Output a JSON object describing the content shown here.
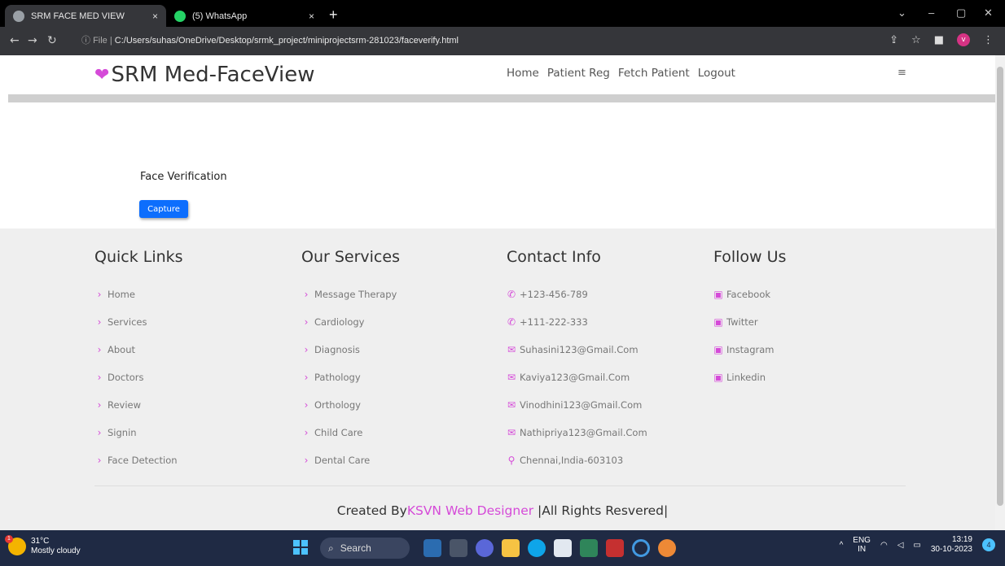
{
  "browser": {
    "tabs": [
      {
        "label": "SRM FACE MED VIEW",
        "active": true
      },
      {
        "label": "(5) WhatsApp",
        "active": false
      }
    ],
    "new_tab": "+",
    "close_glyph": "×",
    "url_prefix": "File",
    "url": "C:/Users/suhas/OneDrive/Desktop/srmk_project/miniprojectsrm-281023/faceverify.html",
    "profile_initial": "v"
  },
  "site": {
    "logo": "SRM Med-FaceView",
    "nav": [
      "Home",
      "Patient Reg",
      "Fetch Patient",
      "Logout"
    ],
    "menu_icon": "≡"
  },
  "main": {
    "title": "Face Verification",
    "capture_label": "Capture"
  },
  "footer": {
    "columns": [
      {
        "heading": "Quick Links",
        "icon": "chevron-right-icon",
        "items": [
          "Home",
          "Services",
          "About",
          "Doctors",
          "Review",
          "Signin",
          "Face Detection"
        ]
      },
      {
        "heading": "Our Services",
        "icon": "chevron-right-icon",
        "items": [
          "Message Therapy",
          "Cardiology",
          "Diagnosis",
          "Pathology",
          "Orthology",
          "Child Care",
          "Dental Care"
        ]
      },
      {
        "heading": "Contact Info",
        "items": [
          {
            "icon": "phone-icon",
            "text": "+123-456-789"
          },
          {
            "icon": "phone-icon",
            "text": "+111-222-333"
          },
          {
            "icon": "envelope-icon",
            "text": "Suhasini123@Gmail.Com"
          },
          {
            "icon": "envelope-icon",
            "text": "Kaviya123@Gmail.Com"
          },
          {
            "icon": "envelope-icon",
            "text": "Vinodhini123@Gmail.Com"
          },
          {
            "icon": "envelope-icon",
            "text": "Nathipriya123@Gmail.Com"
          },
          {
            "icon": "map-marker-icon",
            "text": "Chennai,India-603103"
          }
        ]
      },
      {
        "heading": "Follow Us",
        "icon": "social-icon",
        "items": [
          "Facebook",
          "Twitter",
          "Instagram",
          "Linkedin"
        ]
      }
    ],
    "credit_prefix": "Created By",
    "credit_brand": "KSVN Web Designer",
    "credit_suffix": " |All Rights Resvered|"
  },
  "taskbar": {
    "weather_temp": "31°C",
    "weather_desc": "Mostly cloudy",
    "weather_badge": "1",
    "search_label": "Search",
    "lang_1": "ENG",
    "lang_2": "IN",
    "time": "13:19",
    "date": "30-10-2023",
    "notification_count": "4"
  },
  "colors": {
    "accent": "#d54ad8",
    "button": "#0d6efd",
    "footer_bg": "#efefef"
  }
}
